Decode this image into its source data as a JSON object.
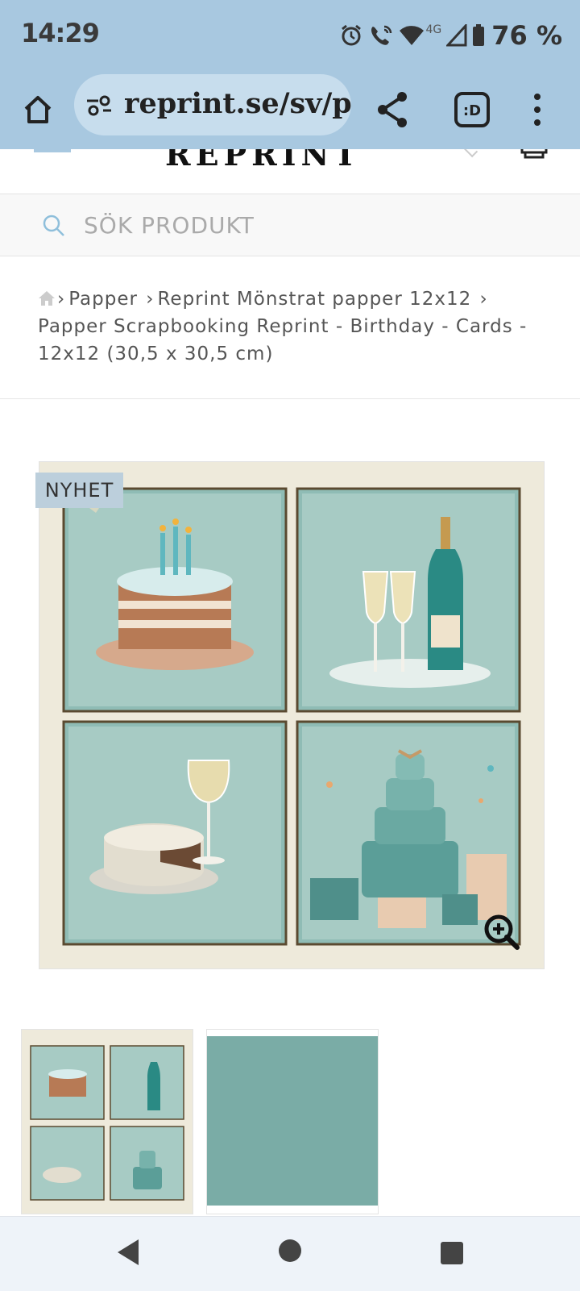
{
  "status_bar": {
    "time": "14:29",
    "network": "4G",
    "battery": "76 %"
  },
  "browser": {
    "url": "reprint.se/sv/p",
    "icons": [
      "home-icon",
      "site-info-icon",
      "share-icon",
      "tab-switcher-icon",
      "more-menu-icon"
    ]
  },
  "site": {
    "logo_text": "REPRINT"
  },
  "search": {
    "placeholder": "SÖK PRODUKT"
  },
  "breadcrumb": {
    "items": [
      "Papper",
      "Reprint Mönstrat papper 12x12"
    ],
    "current": "Papper Scrapbooking Reprint - Birthday - Cards - 12x12 (30,5 x 30,5 cm)"
  },
  "product": {
    "badge": "NYHET",
    "thumbnail_count": 2,
    "colors": {
      "teal": "#7aaca6",
      "paper": "#eeeadb",
      "frame": "#5a4a30"
    }
  },
  "nav": {
    "icons": [
      "back-icon",
      "home-circle-icon",
      "recents-icon"
    ]
  }
}
